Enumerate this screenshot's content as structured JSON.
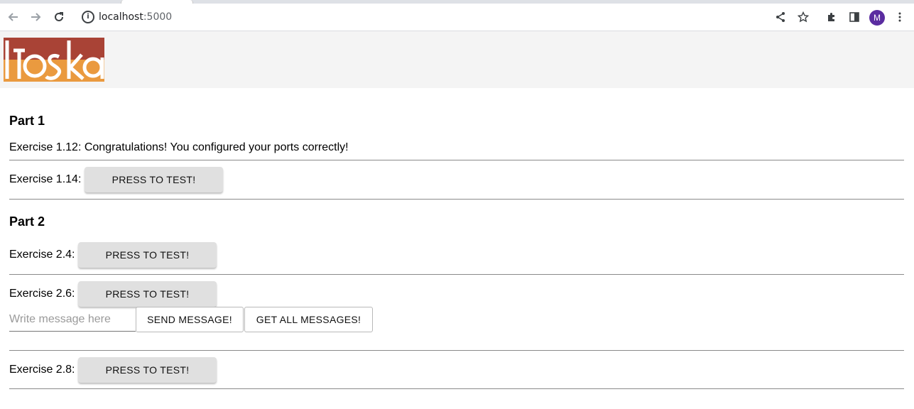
{
  "browser": {
    "url_host": "localhost",
    "url_port": ":5000",
    "profile_initial": "M",
    "icons": {
      "back": "back-arrow-icon",
      "forward": "forward-arrow-icon",
      "reload": "reload-icon",
      "info": "info-icon",
      "share": "share-icon",
      "bookmark": "star-icon",
      "extensions": "puzzle-icon",
      "sidepanel": "side-panel-icon",
      "menu": "kebab-menu-icon"
    }
  },
  "header": {
    "logo_text": "toska",
    "colors": {
      "logo_top": "#a94336",
      "logo_bottom": "#ea9a3f",
      "header_bg": "#f4f4f4"
    }
  },
  "part1": {
    "title": "Part 1",
    "exercise_1_12": "Exercise 1.12: Congratulations! You configured your ports correctly!",
    "exercise_1_14_label": "Exercise 1.14:",
    "exercise_1_14_button": "PRESS TO TEST!"
  },
  "part2": {
    "title": "Part 2",
    "exercise_2_4_label": "Exercise 2.4:",
    "exercise_2_4_button": "PRESS TO TEST!",
    "exercise_2_6_label": "Exercise 2.6:",
    "exercise_2_6_button": "PRESS TO TEST!",
    "message_placeholder": "Write message here",
    "message_value": "",
    "send_button": "SEND MESSAGE!",
    "get_all_button": "GET ALL MESSAGES!",
    "exercise_2_8_label": "Exercise 2.8:",
    "exercise_2_8_button": "PRESS TO TEST!"
  }
}
